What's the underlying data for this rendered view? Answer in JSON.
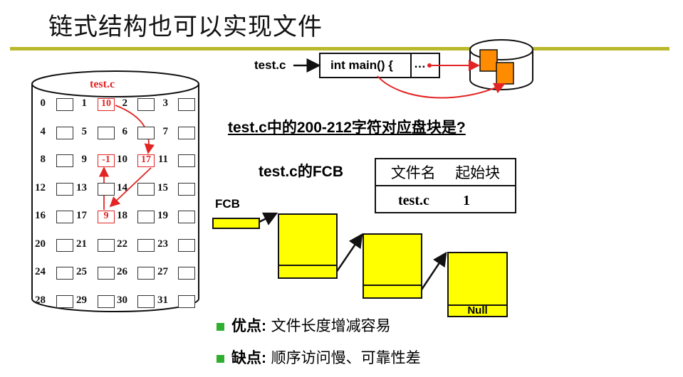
{
  "title": "链式结构也可以实现文件",
  "disk": {
    "file_label": "test.c",
    "cells": [
      {
        "n": "0",
        "v": ""
      },
      {
        "n": "1",
        "v": "10"
      },
      {
        "n": "2",
        "v": ""
      },
      {
        "n": "3",
        "v": ""
      },
      {
        "n": "4",
        "v": ""
      },
      {
        "n": "5",
        "v": ""
      },
      {
        "n": "6",
        "v": ""
      },
      {
        "n": "7",
        "v": ""
      },
      {
        "n": "8",
        "v": ""
      },
      {
        "n": "9",
        "v": "-1"
      },
      {
        "n": "10",
        "v": "17"
      },
      {
        "n": "11",
        "v": ""
      },
      {
        "n": "12",
        "v": ""
      },
      {
        "n": "13",
        "v": ""
      },
      {
        "n": "14",
        "v": ""
      },
      {
        "n": "15",
        "v": ""
      },
      {
        "n": "16",
        "v": ""
      },
      {
        "n": "17",
        "v": "9"
      },
      {
        "n": "18",
        "v": ""
      },
      {
        "n": "19",
        "v": ""
      },
      {
        "n": "20",
        "v": ""
      },
      {
        "n": "21",
        "v": ""
      },
      {
        "n": "22",
        "v": ""
      },
      {
        "n": "23",
        "v": ""
      },
      {
        "n": "24",
        "v": ""
      },
      {
        "n": "25",
        "v": ""
      },
      {
        "n": "26",
        "v": ""
      },
      {
        "n": "27",
        "v": ""
      },
      {
        "n": "28",
        "v": ""
      },
      {
        "n": "29",
        "v": ""
      },
      {
        "n": "30",
        "v": ""
      },
      {
        "n": "31",
        "v": ""
      }
    ]
  },
  "code": {
    "file": "test.c",
    "content": "int main() {",
    "ellipsis": "…"
  },
  "question": "test.c中的200-212字符对应盘块是?",
  "fcb": {
    "caption": "test.c的FCB",
    "col1": "文件名",
    "col2": "起始块",
    "name": "test.c",
    "start": "1"
  },
  "chain": {
    "fcb_label": "FCB",
    "null_label": "Null"
  },
  "bullets": [
    {
      "head": "优点:",
      "text": " 文件长度增减容易"
    },
    {
      "head": "缺点:",
      "text": " 顺序访问慢、可靠性差"
    }
  ],
  "colors": {
    "rule": "#b9b92d",
    "accent_red": "#e32424",
    "block_yellow": "#ffff00",
    "bullet_green": "#2fae2f",
    "disk_orange": "#ff8c00"
  }
}
